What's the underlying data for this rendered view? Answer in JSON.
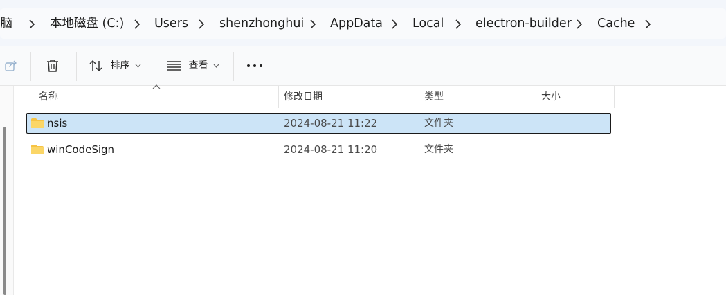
{
  "breadcrumb": {
    "items": [
      "电脑",
      "本地磁盘 (C:)",
      "Users",
      "shenzhonghui",
      "AppData",
      "Local",
      "electron-builder",
      "Cache"
    ]
  },
  "toolbar": {
    "sort_label": "排序",
    "view_label": "查看"
  },
  "columns": {
    "name": "名称",
    "date": "修改日期",
    "type": "类型",
    "size": "大小"
  },
  "files": [
    {
      "name": "nsis",
      "modified": "2024-08-21 11:22",
      "type": "文件夹",
      "size": "",
      "selected": true
    },
    {
      "name": "winCodeSign",
      "modified": "2024-08-21 11:20",
      "type": "文件夹",
      "size": "",
      "selected": false
    }
  ],
  "colors": {
    "selection": "#cce4f7",
    "folder": "#f7c948"
  },
  "icons": [
    "share-icon",
    "trash-icon",
    "sort-icon",
    "view-icon",
    "more-icon",
    "folder-icon",
    "chevron-right-icon",
    "chevron-down-icon"
  ]
}
